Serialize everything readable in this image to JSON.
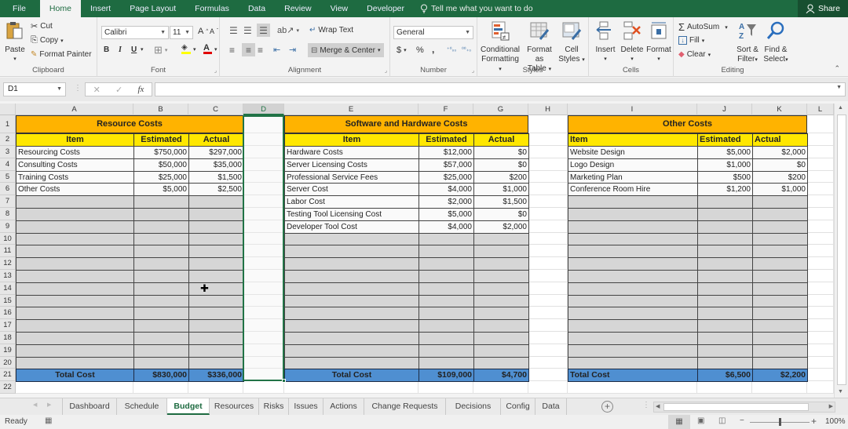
{
  "menu": {
    "tabs": [
      "File",
      "Home",
      "Insert",
      "Page Layout",
      "Formulas",
      "Data",
      "Review",
      "View",
      "Developer"
    ],
    "active_tab": "Home",
    "tell_me": "Tell me what you want to do",
    "share": "Share"
  },
  "ribbon": {
    "clipboard": {
      "label": "Clipboard",
      "paste": "Paste",
      "cut": "Cut",
      "copy": "Copy",
      "format_painter": "Format Painter"
    },
    "font": {
      "label": "Font",
      "font_name": "Calibri",
      "font_size": "11",
      "bold": "B",
      "italic": "I",
      "underline": "U",
      "highlight_color": "#ffff00",
      "font_color": "#e00000"
    },
    "alignment": {
      "label": "Alignment",
      "wrap_text": "Wrap Text",
      "merge_center": "Merge & Center"
    },
    "number": {
      "label": "Number",
      "format": "General",
      "currency": "$",
      "percent": "%",
      "comma": ",",
      "inc_decimal": "←.0 .00",
      "dec_decimal": ".00 →.0"
    },
    "styles": {
      "label": "Styles",
      "conditional": [
        "Conditional",
        "Formatting"
      ],
      "format_table": [
        "Format as",
        "Table"
      ],
      "cell_styles": [
        "Cell",
        "Styles"
      ]
    },
    "cells": {
      "label": "Cells",
      "insert": "Insert",
      "delete": "Delete",
      "format": "Format"
    },
    "editing": {
      "label": "Editing",
      "autosum": "AutoSum",
      "fill": "Fill",
      "clear": "Clear",
      "sort_filter": [
        "Sort &",
        "Filter"
      ],
      "find_select": [
        "Find &",
        "Select"
      ]
    }
  },
  "formula_bar": {
    "name_box": "D1",
    "formula": ""
  },
  "columns": [
    "A",
    "B",
    "C",
    "D",
    "E",
    "F",
    "G",
    "H",
    "I",
    "J",
    "K",
    "L"
  ],
  "selected_column": "D",
  "rows": [
    "1",
    "2",
    "3",
    "4",
    "5",
    "6",
    "7",
    "8",
    "9",
    "10",
    "11",
    "12",
    "13",
    "14",
    "15",
    "16",
    "17",
    "18",
    "19",
    "20",
    "21",
    "22"
  ],
  "tables": [
    {
      "title": "Resource Costs",
      "headers": [
        "Item",
        "Estimated",
        "Actual"
      ],
      "rows": [
        [
          "Resourcing Costs",
          "$750,000",
          "$297,000"
        ],
        [
          "Consulting Costs",
          "$50,000",
          "$35,000"
        ],
        [
          "Training Costs",
          "$25,000",
          "$1,500"
        ],
        [
          "Other Costs",
          "$5,000",
          "$2,500"
        ]
      ],
      "total": [
        "Total Cost",
        "$830,000",
        "$336,000"
      ]
    },
    {
      "title": "Software and Hardware Costs",
      "headers": [
        "Item",
        "Estimated",
        "Actual"
      ],
      "rows": [
        [
          "Hardware Costs",
          "$12,000",
          "$0"
        ],
        [
          "Server Licensing Costs",
          "$57,000",
          "$0"
        ],
        [
          "Professional Service Fees",
          "$25,000",
          "$200"
        ],
        [
          "Server Cost",
          "$4,000",
          "$1,000"
        ],
        [
          "Labor Cost",
          "$2,000",
          "$1,500"
        ],
        [
          "Testing Tool Licensing Cost",
          "$5,000",
          "$0"
        ],
        [
          "Developer Tool Cost",
          "$4,000",
          "$2,000"
        ]
      ],
      "total": [
        "Total Cost",
        "$109,000",
        "$4,700"
      ]
    },
    {
      "title": "Other Costs",
      "headers": [
        "Item",
        "Estimated",
        "Actual"
      ],
      "rows": [
        [
          "Website Design",
          "$5,000",
          "$2,000"
        ],
        [
          "Logo Design",
          "$1,000",
          "$0"
        ],
        [
          "Marketing Plan",
          "$500",
          "$200"
        ],
        [
          "Conference Room Hire",
          "$1,200",
          "$1,000"
        ]
      ],
      "total": [
        "Total Cost",
        "$6,500",
        "$2,200"
      ]
    }
  ],
  "colors": {
    "title_bg": "#ffb300",
    "header_bg": "#ffe700",
    "total_bg": "#4f8fd1",
    "empty_bg": "#d6d6d6",
    "excel_green": "#1e6b41"
  },
  "sheet_tabs": [
    "Dashboard",
    "Schedule",
    "Budget",
    "Resources",
    "Risks",
    "Issues",
    "Actions",
    "Change Requests",
    "Decisions",
    "Config",
    "Data"
  ],
  "active_sheet": "Budget",
  "status": {
    "ready": "Ready",
    "zoom": "100%",
    "zoom_level_percent": 100
  }
}
